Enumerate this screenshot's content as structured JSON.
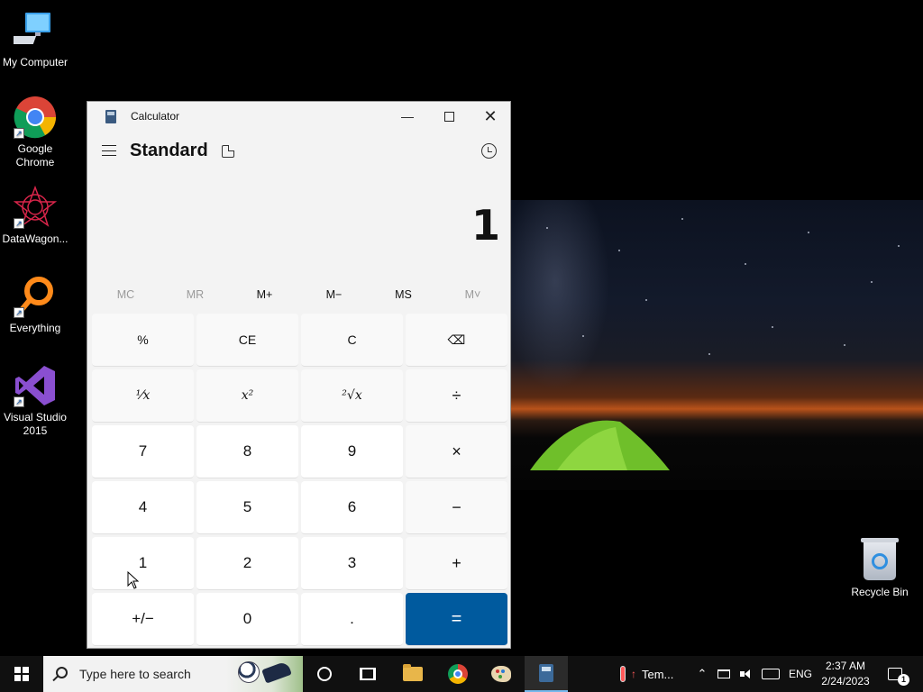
{
  "desktop": {
    "icons": [
      {
        "label": "My Computer",
        "icon": "computer-icon"
      },
      {
        "label": "Google Chrome",
        "icon": "chrome-icon"
      },
      {
        "label": "DataWagon...",
        "icon": "datawagon-icon"
      },
      {
        "label": "Everything",
        "icon": "everything-search-icon"
      },
      {
        "label": "Visual Studio 2015",
        "icon": "visual-studio-icon"
      }
    ],
    "recycle_bin": {
      "label": "Recycle Bin",
      "icon": "recycle-bin-icon"
    }
  },
  "calculator": {
    "window_title": "Calculator",
    "mode": "Standard",
    "display_value": "1",
    "memory_buttons": [
      {
        "label": "MC",
        "enabled": false
      },
      {
        "label": "MR",
        "enabled": false
      },
      {
        "label": "M+",
        "enabled": true
      },
      {
        "label": "M−",
        "enabled": true
      },
      {
        "label": "MS",
        "enabled": true
      },
      {
        "label": "M˅",
        "enabled": false
      }
    ],
    "keys": [
      {
        "label": "%",
        "type": "fn",
        "name": "percent"
      },
      {
        "label": "CE",
        "type": "fn",
        "name": "clear-entry"
      },
      {
        "label": "C",
        "type": "fn",
        "name": "clear"
      },
      {
        "label": "⌫",
        "type": "fn",
        "name": "backspace"
      },
      {
        "label": "¹⁄x",
        "type": "fn",
        "name": "reciprocal"
      },
      {
        "label": "x²",
        "type": "fn",
        "name": "square"
      },
      {
        "label": "²√x",
        "type": "fn",
        "name": "square-root"
      },
      {
        "label": "÷",
        "type": "op",
        "name": "divide"
      },
      {
        "label": "7",
        "type": "num",
        "name": "digit-7"
      },
      {
        "label": "8",
        "type": "num",
        "name": "digit-8"
      },
      {
        "label": "9",
        "type": "num",
        "name": "digit-9"
      },
      {
        "label": "×",
        "type": "op",
        "name": "multiply"
      },
      {
        "label": "4",
        "type": "num",
        "name": "digit-4"
      },
      {
        "label": "5",
        "type": "num",
        "name": "digit-5"
      },
      {
        "label": "6",
        "type": "num",
        "name": "digit-6"
      },
      {
        "label": "−",
        "type": "op",
        "name": "subtract"
      },
      {
        "label": "1",
        "type": "num",
        "name": "digit-1"
      },
      {
        "label": "2",
        "type": "num",
        "name": "digit-2"
      },
      {
        "label": "3",
        "type": "num",
        "name": "digit-3"
      },
      {
        "label": "+",
        "type": "op",
        "name": "add"
      },
      {
        "label": "+/−",
        "type": "num",
        "name": "negate"
      },
      {
        "label": "0",
        "type": "num",
        "name": "digit-0"
      },
      {
        "label": ".",
        "type": "num",
        "name": "decimal"
      },
      {
        "label": "=",
        "type": "equals",
        "name": "equals"
      }
    ],
    "accent_color": "#005a9e"
  },
  "taskbar": {
    "search_placeholder": "Type here to search",
    "weather_text": "Tem...",
    "language": "ENG",
    "time": "2:37 AM",
    "date": "2/24/2023",
    "notification_count": "1"
  }
}
